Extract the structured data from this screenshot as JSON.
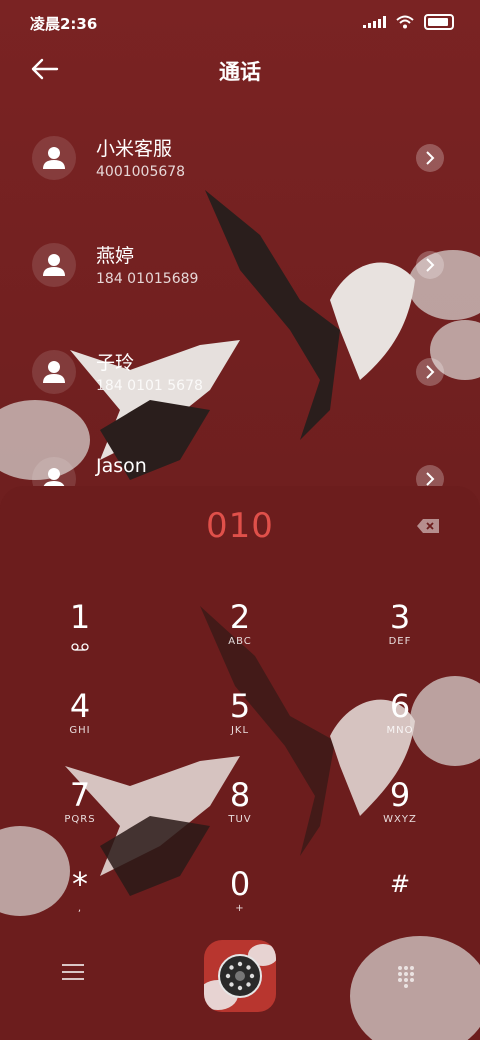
{
  "status": {
    "time": "凌晨2:36"
  },
  "header": {
    "title": "通话"
  },
  "contacts": [
    {
      "name": "小米客服",
      "number": "4001005678"
    },
    {
      "name": "燕婷",
      "number": "184 01015689"
    },
    {
      "name": "子玲",
      "number": "184 0101 5678"
    },
    {
      "name": "Jason",
      "number": ""
    }
  ],
  "dialer": {
    "input": "010",
    "keys": [
      {
        "digit": "1",
        "letters": ""
      },
      {
        "digit": "2",
        "letters": "ABC"
      },
      {
        "digit": "3",
        "letters": "DEF"
      },
      {
        "digit": "4",
        "letters": "GHI"
      },
      {
        "digit": "5",
        "letters": "JKL"
      },
      {
        "digit": "6",
        "letters": "MNO"
      },
      {
        "digit": "7",
        "letters": "PQRS"
      },
      {
        "digit": "8",
        "letters": "TUV"
      },
      {
        "digit": "9",
        "letters": "WXYZ"
      },
      {
        "digit": "*",
        "letters": ","
      },
      {
        "digit": "0",
        "letters": "+"
      },
      {
        "digit": "#",
        "letters": ""
      }
    ]
  },
  "icons": {
    "back": "arrow-left-icon",
    "delete": "backspace-icon",
    "menu": "menu-icon",
    "call": "call-icon",
    "keypad": "keypad-icon"
  },
  "colors": {
    "background": "#6e1e1e",
    "accent_number": "#e0504a"
  }
}
